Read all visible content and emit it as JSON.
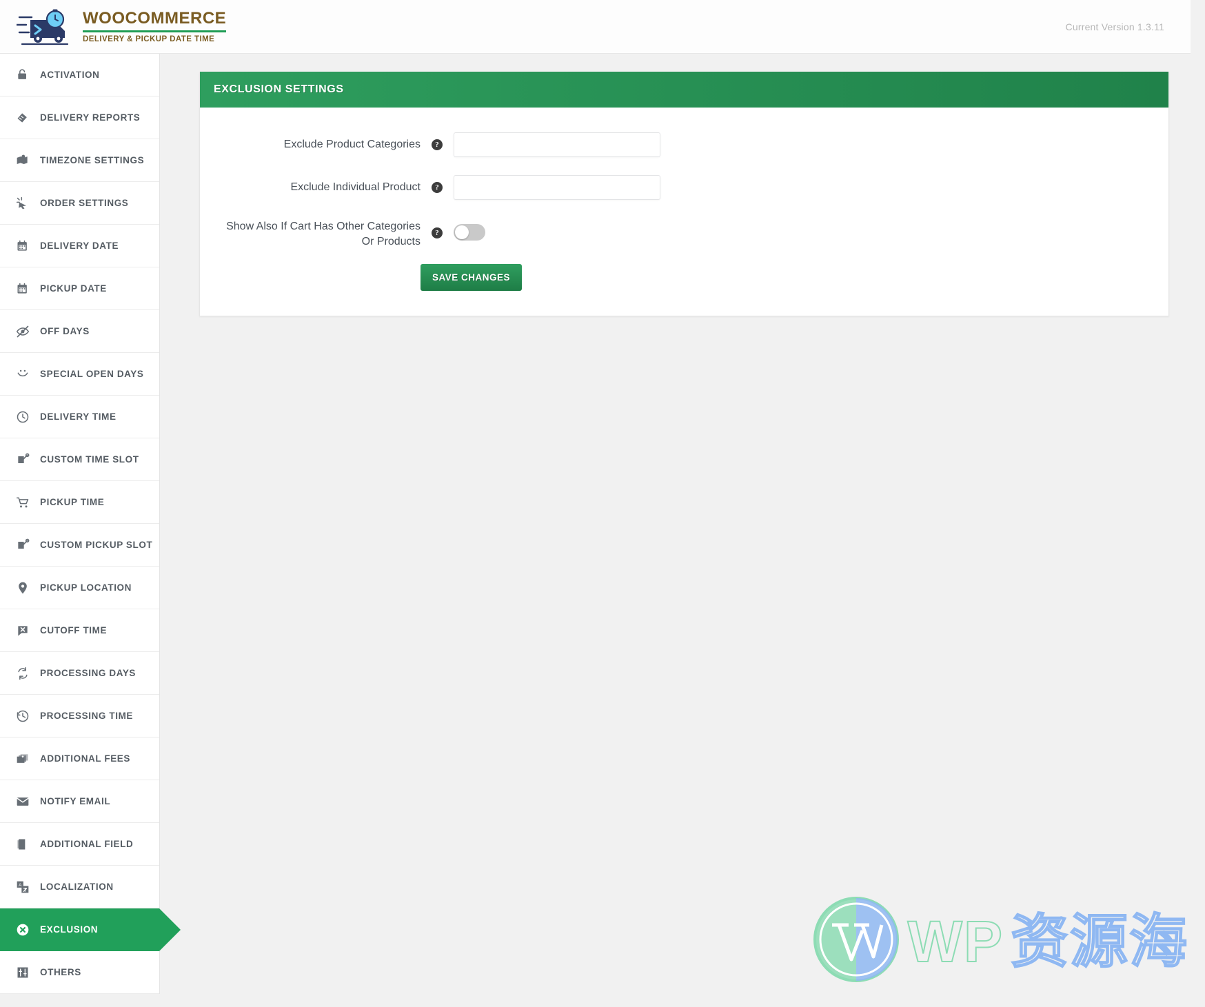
{
  "header": {
    "logo_icon": "delivery-truck-clock-icon",
    "brand_title": "WOOCOMMERCE",
    "brand_subtitle": "DELIVERY & PICKUP DATE TIME",
    "version_text": "Current Version 1.3.11"
  },
  "colors": {
    "accent_green": "#21a05a",
    "panel_header_green_start": "#2e9e5e",
    "panel_header_green_end": "#20824a",
    "brand_brown": "#7a5c22",
    "nav_text": "#555c63",
    "page_background": "#f1f1f1"
  },
  "sidebar": {
    "items": [
      {
        "label": "ACTIVATION",
        "icon": "lock-icon",
        "active": false
      },
      {
        "label": "DELIVERY REPORTS",
        "icon": "report-icon",
        "active": false
      },
      {
        "label": "TIMEZONE SETTINGS",
        "icon": "map-pin-flag-icon",
        "active": false
      },
      {
        "label": "ORDER SETTINGS",
        "icon": "click-cursor-icon",
        "active": false
      },
      {
        "label": "DELIVERY DATE",
        "icon": "calendar-icon",
        "active": false
      },
      {
        "label": "PICKUP DATE",
        "icon": "calendar-icon",
        "active": false
      },
      {
        "label": "OFF DAYS",
        "icon": "eye-slash-icon",
        "active": false
      },
      {
        "label": "SPECIAL OPEN DAYS",
        "icon": "smiley-icon",
        "active": false
      },
      {
        "label": "DELIVERY TIME",
        "icon": "clock-icon",
        "active": false
      },
      {
        "label": "CUSTOM TIME SLOT",
        "icon": "note-pencil-icon",
        "active": false
      },
      {
        "label": "PICKUP TIME",
        "icon": "shopping-cart-icon",
        "active": false
      },
      {
        "label": "CUSTOM PICKUP SLOT",
        "icon": "note-pencil-icon",
        "active": false
      },
      {
        "label": "PICKUP LOCATION",
        "icon": "location-pin-icon",
        "active": false
      },
      {
        "label": "CUTOFF TIME",
        "icon": "speech-bubble-x-icon",
        "active": false
      },
      {
        "label": "PROCESSING DAYS",
        "icon": "refresh-cycle-icon",
        "active": false
      },
      {
        "label": "PROCESSING TIME",
        "icon": "clock-rewind-icon",
        "active": false
      },
      {
        "label": "ADDITIONAL FEES",
        "icon": "images-stack-icon",
        "active": false
      },
      {
        "label": "NOTIFY EMAIL",
        "icon": "envelope-icon",
        "active": false
      },
      {
        "label": "ADDITIONAL FIELD",
        "icon": "book-icon",
        "active": false
      },
      {
        "label": "LOCALIZATION",
        "icon": "translate-icon",
        "active": false
      },
      {
        "label": "EXCLUSION",
        "icon": "circle-x-icon",
        "active": true
      },
      {
        "label": "OTHERS",
        "icon": "sliders-icon",
        "active": false
      }
    ]
  },
  "panel": {
    "title": "EXCLUSION SETTINGS",
    "fields": [
      {
        "label": "Exclude Product Categories",
        "help_icon": "question-mark-icon",
        "type": "text",
        "value": "",
        "placeholder": ""
      },
      {
        "label": "Exclude Individual Product",
        "help_icon": "question-mark-icon",
        "type": "text",
        "value": "",
        "placeholder": ""
      }
    ],
    "toggle_field": {
      "label_line1": "Show Also If Cart Has Other Categories",
      "label_line2": "Or Products",
      "help_icon": "question-mark-icon",
      "type": "toggle",
      "state": "off"
    },
    "save_label": "SAVE CHANGES"
  },
  "watermark": {
    "logo_icon": "wordpress-logo-icon",
    "text_latin": "WP",
    "text_cjk": "资源海"
  }
}
